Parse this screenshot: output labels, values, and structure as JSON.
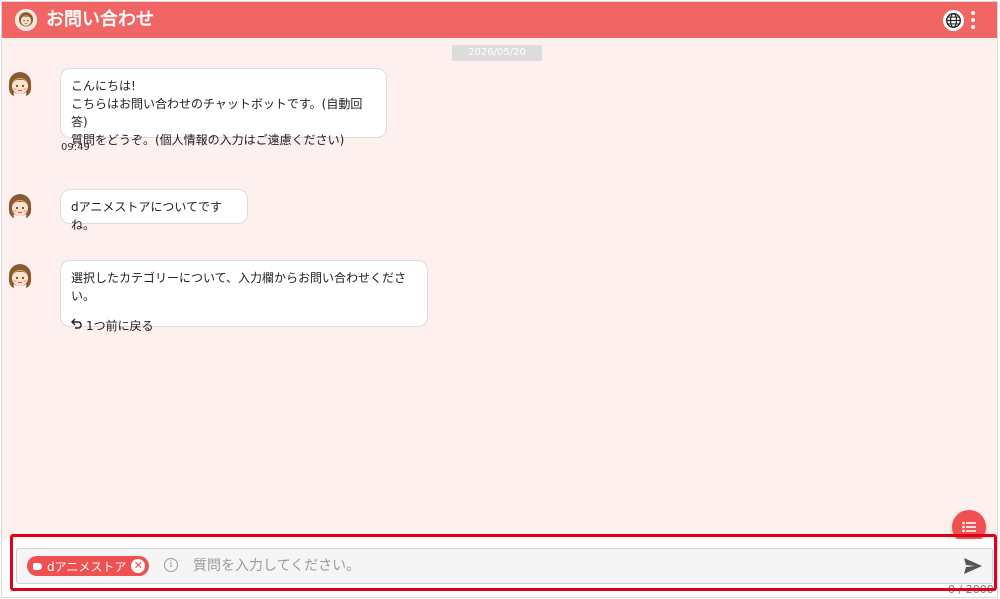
{
  "header": {
    "title": "お問い合わせ"
  },
  "chat": {
    "date": "2026/05/20",
    "messages": [
      {
        "lines": [
          "こんにちは!",
          "こちらはお問い合わせのチャットボットです。(自動回答)",
          "質問をどうぞ。(個人情報の入力はご遠慮ください)"
        ],
        "time": "09:49"
      },
      {
        "lines": [
          "dアニメストアについてですね。"
        ]
      },
      {
        "lines": [
          "選択したカテゴリーについて、入力欄からお問い合わせください。"
        ],
        "back_label": "1つ前に戻る"
      }
    ]
  },
  "input": {
    "chip_label": "dアニメストア",
    "placeholder": "質問を入力してください。",
    "counter": "0 / 2000"
  },
  "colors": {
    "accent": "#f26565",
    "background": "#fff0f0",
    "highlight": "#e0001a"
  },
  "icons": [
    "operator-avatar-icon",
    "globe-icon",
    "kebab-menu-icon",
    "list-icon",
    "tag-icon",
    "close-icon",
    "info-icon",
    "send-icon",
    "undo-arrow-icon"
  ]
}
